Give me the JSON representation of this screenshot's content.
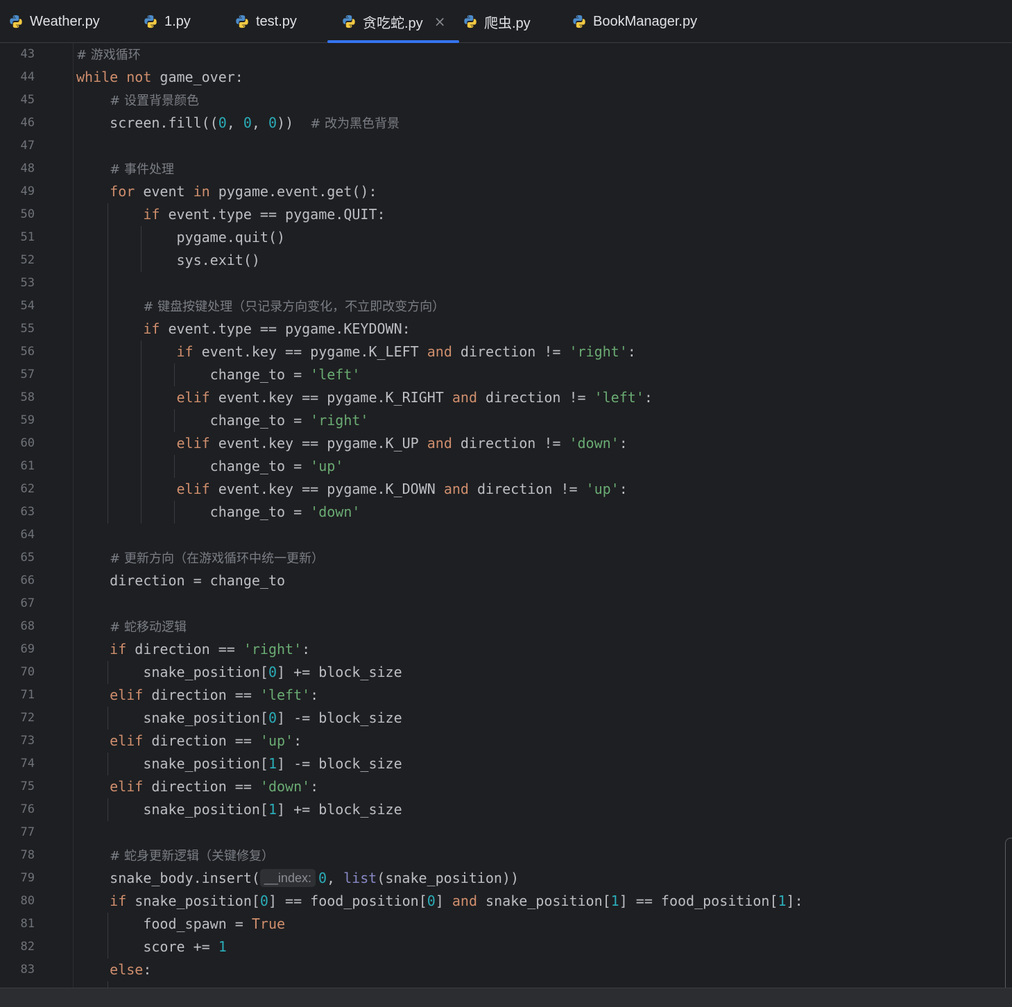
{
  "tabs": [
    {
      "label": "Weather.py",
      "icon": "python-icon",
      "active": false
    },
    {
      "label": "1.py",
      "icon": "python-icon",
      "active": false
    },
    {
      "label": "test.py",
      "icon": "python-icon",
      "active": false
    },
    {
      "label": "贪吃蛇.py",
      "icon": "python-icon",
      "active": true,
      "close": "×"
    },
    {
      "label": "爬虫.py",
      "icon": "python-icon",
      "active": false
    },
    {
      "label": "BookManager.py",
      "icon": "python-icon",
      "active": false
    }
  ],
  "colors": {
    "background": "#1e1f22",
    "keyword": "#cf8e6d",
    "string": "#6aab73",
    "number": "#2aacb8",
    "comment": "#7a7e85",
    "text": "#bcbec4",
    "builtin": "#8888c6",
    "active_tab_underline": "#3574f0"
  },
  "editor": {
    "lines": [
      {
        "n": "43",
        "tokens": [
          [
            "cmt",
            "# 游戏循环"
          ]
        ]
      },
      {
        "n": "44",
        "tokens": [
          [
            "kw",
            "while"
          ],
          [
            "def",
            " "
          ],
          [
            "kw",
            "not"
          ],
          [
            "def",
            " game_over:"
          ]
        ]
      },
      {
        "n": "45",
        "tokens": [
          [
            "def",
            "    "
          ],
          [
            "cmt",
            "# 设置背景颜色"
          ]
        ]
      },
      {
        "n": "46",
        "tokens": [
          [
            "def",
            "    screen.fill(("
          ],
          [
            "num",
            "0"
          ],
          [
            "def",
            ", "
          ],
          [
            "num",
            "0"
          ],
          [
            "def",
            ", "
          ],
          [
            "num",
            "0"
          ],
          [
            "def",
            "))  "
          ],
          [
            "cmt",
            "# 改为黑色背景"
          ]
        ]
      },
      {
        "n": "47",
        "tokens": []
      },
      {
        "n": "48",
        "tokens": [
          [
            "def",
            "    "
          ],
          [
            "cmt",
            "# 事件处理"
          ]
        ]
      },
      {
        "n": "49",
        "tokens": [
          [
            "def",
            "    "
          ],
          [
            "kw",
            "for"
          ],
          [
            "def",
            " event "
          ],
          [
            "kw",
            "in"
          ],
          [
            "def",
            " pygame.event.get():"
          ]
        ]
      },
      {
        "n": "50",
        "tokens": [
          [
            "def",
            "        "
          ],
          [
            "kw",
            "if"
          ],
          [
            "def",
            " event.type == pygame.QUIT:"
          ]
        ]
      },
      {
        "n": "51",
        "tokens": [
          [
            "def",
            "            pygame.quit()"
          ]
        ]
      },
      {
        "n": "52",
        "tokens": [
          [
            "def",
            "            sys.exit()"
          ]
        ]
      },
      {
        "n": "53",
        "tokens": []
      },
      {
        "n": "54",
        "tokens": [
          [
            "def",
            "        "
          ],
          [
            "cmt",
            "# 键盘按键处理（只记录方向变化，不立即改变方向）"
          ]
        ]
      },
      {
        "n": "55",
        "tokens": [
          [
            "def",
            "        "
          ],
          [
            "kw",
            "if"
          ],
          [
            "def",
            " event.type == pygame.KEYDOWN:"
          ]
        ]
      },
      {
        "n": "56",
        "tokens": [
          [
            "def",
            "            "
          ],
          [
            "kw",
            "if"
          ],
          [
            "def",
            " event.key == pygame.K_LEFT "
          ],
          [
            "kw",
            "and"
          ],
          [
            "def",
            " direction != "
          ],
          [
            "str",
            "'right'"
          ],
          [
            "def",
            ":"
          ]
        ]
      },
      {
        "n": "57",
        "tokens": [
          [
            "def",
            "                change_to = "
          ],
          [
            "str",
            "'left'"
          ]
        ]
      },
      {
        "n": "58",
        "tokens": [
          [
            "def",
            "            "
          ],
          [
            "kw",
            "elif"
          ],
          [
            "def",
            " event.key == pygame.K_RIGHT "
          ],
          [
            "kw",
            "and"
          ],
          [
            "def",
            " direction != "
          ],
          [
            "str",
            "'left'"
          ],
          [
            "def",
            ":"
          ]
        ]
      },
      {
        "n": "59",
        "tokens": [
          [
            "def",
            "                change_to = "
          ],
          [
            "str",
            "'right'"
          ]
        ]
      },
      {
        "n": "60",
        "tokens": [
          [
            "def",
            "            "
          ],
          [
            "kw",
            "elif"
          ],
          [
            "def",
            " event.key == pygame.K_UP "
          ],
          [
            "kw",
            "and"
          ],
          [
            "def",
            " direction != "
          ],
          [
            "str",
            "'down'"
          ],
          [
            "def",
            ":"
          ]
        ]
      },
      {
        "n": "61",
        "tokens": [
          [
            "def",
            "                change_to = "
          ],
          [
            "str",
            "'up'"
          ]
        ]
      },
      {
        "n": "62",
        "tokens": [
          [
            "def",
            "            "
          ],
          [
            "kw",
            "elif"
          ],
          [
            "def",
            " event.key == pygame.K_DOWN "
          ],
          [
            "kw",
            "and"
          ],
          [
            "def",
            " direction != "
          ],
          [
            "str",
            "'up'"
          ],
          [
            "def",
            ":"
          ]
        ]
      },
      {
        "n": "63",
        "tokens": [
          [
            "def",
            "                change_to = "
          ],
          [
            "str",
            "'down'"
          ]
        ]
      },
      {
        "n": "64",
        "tokens": []
      },
      {
        "n": "65",
        "tokens": [
          [
            "def",
            "    "
          ],
          [
            "cmt",
            "# 更新方向（在游戏循环中统一更新）"
          ]
        ]
      },
      {
        "n": "66",
        "tokens": [
          [
            "def",
            "    direction = change_to"
          ]
        ]
      },
      {
        "n": "67",
        "tokens": []
      },
      {
        "n": "68",
        "tokens": [
          [
            "def",
            "    "
          ],
          [
            "cmt",
            "# 蛇移动逻辑"
          ]
        ]
      },
      {
        "n": "69",
        "tokens": [
          [
            "def",
            "    "
          ],
          [
            "kw",
            "if"
          ],
          [
            "def",
            " direction == "
          ],
          [
            "str",
            "'right'"
          ],
          [
            "def",
            ":"
          ]
        ]
      },
      {
        "n": "70",
        "tokens": [
          [
            "def",
            "        snake_position["
          ],
          [
            "num",
            "0"
          ],
          [
            "def",
            "] += block_size"
          ]
        ]
      },
      {
        "n": "71",
        "tokens": [
          [
            "def",
            "    "
          ],
          [
            "kw",
            "elif"
          ],
          [
            "def",
            " direction == "
          ],
          [
            "str",
            "'left'"
          ],
          [
            "def",
            ":"
          ]
        ]
      },
      {
        "n": "72",
        "tokens": [
          [
            "def",
            "        snake_position["
          ],
          [
            "num",
            "0"
          ],
          [
            "def",
            "] -= block_size"
          ]
        ]
      },
      {
        "n": "73",
        "tokens": [
          [
            "def",
            "    "
          ],
          [
            "kw",
            "elif"
          ],
          [
            "def",
            " direction == "
          ],
          [
            "str",
            "'up'"
          ],
          [
            "def",
            ":"
          ]
        ]
      },
      {
        "n": "74",
        "tokens": [
          [
            "def",
            "        snake_position["
          ],
          [
            "num",
            "1"
          ],
          [
            "def",
            "] -= block_size"
          ]
        ]
      },
      {
        "n": "75",
        "tokens": [
          [
            "def",
            "    "
          ],
          [
            "kw",
            "elif"
          ],
          [
            "def",
            " direction == "
          ],
          [
            "str",
            "'down'"
          ],
          [
            "def",
            ":"
          ]
        ]
      },
      {
        "n": "76",
        "tokens": [
          [
            "def",
            "        snake_position["
          ],
          [
            "num",
            "1"
          ],
          [
            "def",
            "] += block_size"
          ]
        ]
      },
      {
        "n": "77",
        "tokens": []
      },
      {
        "n": "78",
        "tokens": [
          [
            "def",
            "    "
          ],
          [
            "cmt",
            "# 蛇身更新逻辑（关键修复）"
          ]
        ]
      },
      {
        "n": "79",
        "tokens": [
          [
            "def",
            "    snake_body.insert("
          ],
          [
            "hint",
            "__index:"
          ],
          [
            "num",
            "0"
          ],
          [
            "def",
            ", "
          ],
          [
            "builtin",
            "list"
          ],
          [
            "def",
            "(snake_position))"
          ]
        ]
      },
      {
        "n": "80",
        "tokens": [
          [
            "def",
            "    "
          ],
          [
            "kw",
            "if"
          ],
          [
            "def",
            " snake_position["
          ],
          [
            "num",
            "0"
          ],
          [
            "def",
            "] == food_position["
          ],
          [
            "num",
            "0"
          ],
          [
            "def",
            "] "
          ],
          [
            "kw",
            "and"
          ],
          [
            "def",
            " snake_position["
          ],
          [
            "num",
            "1"
          ],
          [
            "def",
            "] == food_position["
          ],
          [
            "num",
            "1"
          ],
          [
            "def",
            "]:"
          ]
        ]
      },
      {
        "n": "81",
        "tokens": [
          [
            "def",
            "        food_spawn = "
          ],
          [
            "kw",
            "True"
          ]
        ]
      },
      {
        "n": "82",
        "tokens": [
          [
            "def",
            "        score += "
          ],
          [
            "num",
            "1"
          ]
        ]
      },
      {
        "n": "83",
        "tokens": [
          [
            "def",
            "    "
          ],
          [
            "kw",
            "else"
          ],
          [
            "def",
            ":"
          ]
        ]
      }
    ]
  }
}
